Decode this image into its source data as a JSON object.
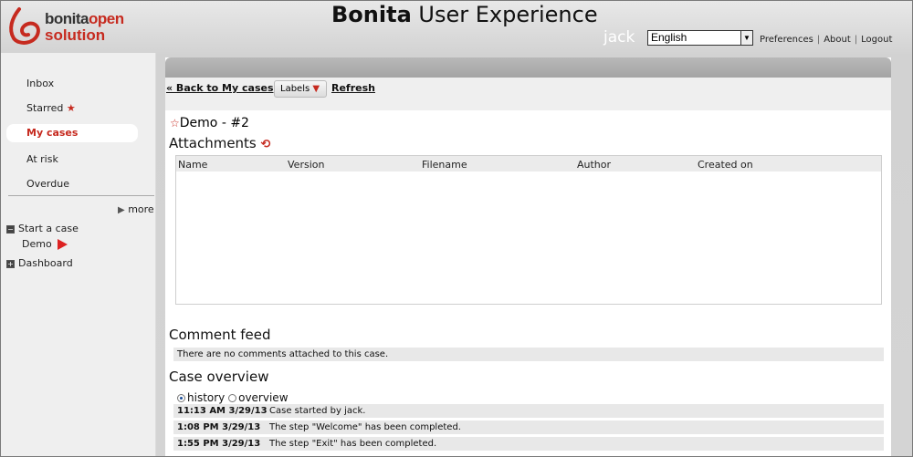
{
  "header": {
    "logo_line1_a": "bonita",
    "logo_line1_b": "open",
    "logo_line2": "solution",
    "title_bold": "Bonita",
    "title_rest": "User Experience",
    "username": "jack",
    "language": "English",
    "links": [
      "Preferences",
      "About",
      "Logout"
    ]
  },
  "sidebar": {
    "items": [
      {
        "label": "Inbox"
      },
      {
        "label": "Starred"
      },
      {
        "label": "My cases"
      },
      {
        "label": "At risk"
      },
      {
        "label": "Overdue"
      }
    ],
    "more_label": "more",
    "start_case_label": "Start a case",
    "process_label": "Demo",
    "dashboard_label": "Dashboard"
  },
  "toolbar": {
    "back_label": "« Back to My cases",
    "labels_label": "Labels",
    "refresh_label": "Refresh"
  },
  "case": {
    "title": "Demo - #2"
  },
  "attachments": {
    "title": "Attachments",
    "columns": [
      "Name",
      "Version",
      "Filename",
      "Author",
      "Created on"
    ]
  },
  "comments": {
    "title": "Comment feed",
    "empty_text": "There are no comments attached to this case."
  },
  "overview": {
    "title": "Case overview",
    "radio_options": [
      "history",
      "overview"
    ],
    "selected": "history",
    "events": [
      {
        "time": "11:13 AM 3/29/13",
        "text": "Case started by jack."
      },
      {
        "time": "1:08 PM 3/29/13",
        "text": "The step \"Welcome\" has been completed."
      },
      {
        "time": "1:55 PM 3/29/13",
        "text": "The step \"Exit\" has been completed."
      }
    ]
  },
  "colors": {
    "accent": "#c62a1f",
    "background": "#d9d9d9",
    "panel_bar": "#a8a8a8"
  }
}
